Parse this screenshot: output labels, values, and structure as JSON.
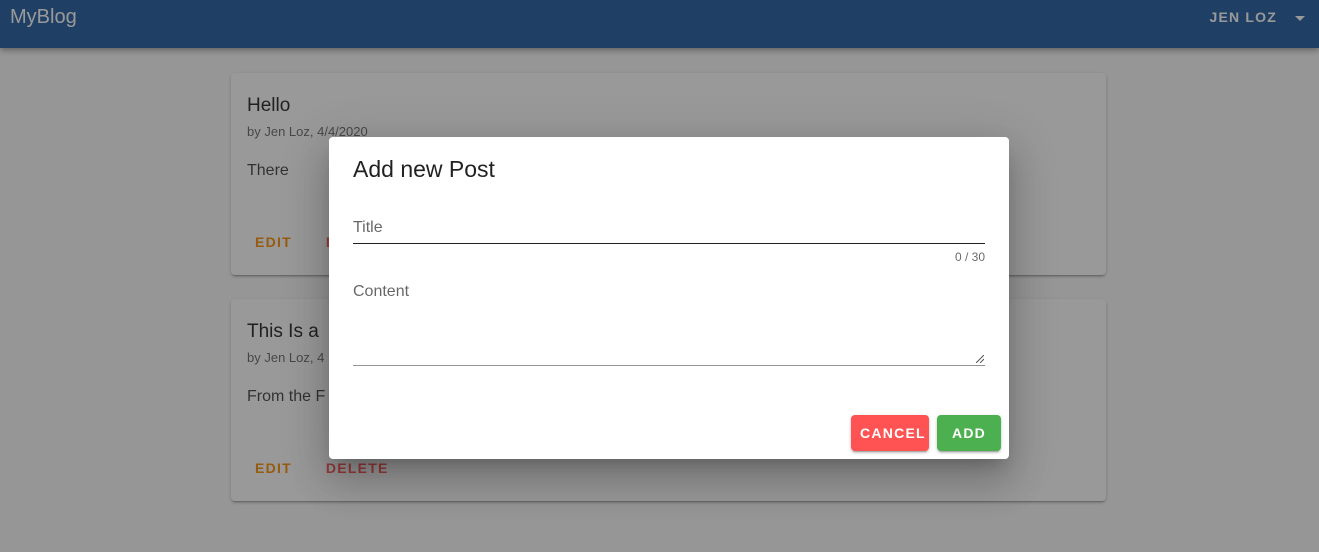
{
  "app": {
    "brand": "MyBlog",
    "user_name": "JEN LOZ"
  },
  "posts": [
    {
      "title": "Hello",
      "subtitle": "by Jen Loz, 4/4/2020",
      "content": "There",
      "edit_label": "EDIT",
      "delete_label": "DELETE"
    },
    {
      "title": "This Is a",
      "subtitle": "by Jen Loz, 4",
      "content": "From the F",
      "edit_label": "EDIT",
      "delete_label": "DELETE"
    }
  ],
  "dialog": {
    "title": "Add new Post",
    "title_field": {
      "placeholder": "Title",
      "value": "",
      "counter": "0 / 30"
    },
    "content_field": {
      "placeholder": "Content",
      "value": ""
    },
    "cancel_label": "CANCEL",
    "add_label": "ADD"
  },
  "colors": {
    "appbar": "#1e5aa0",
    "edit": "#fb8c00",
    "delete": "#ff5252",
    "cancel": "#ff5252",
    "add": "#4caf50"
  }
}
